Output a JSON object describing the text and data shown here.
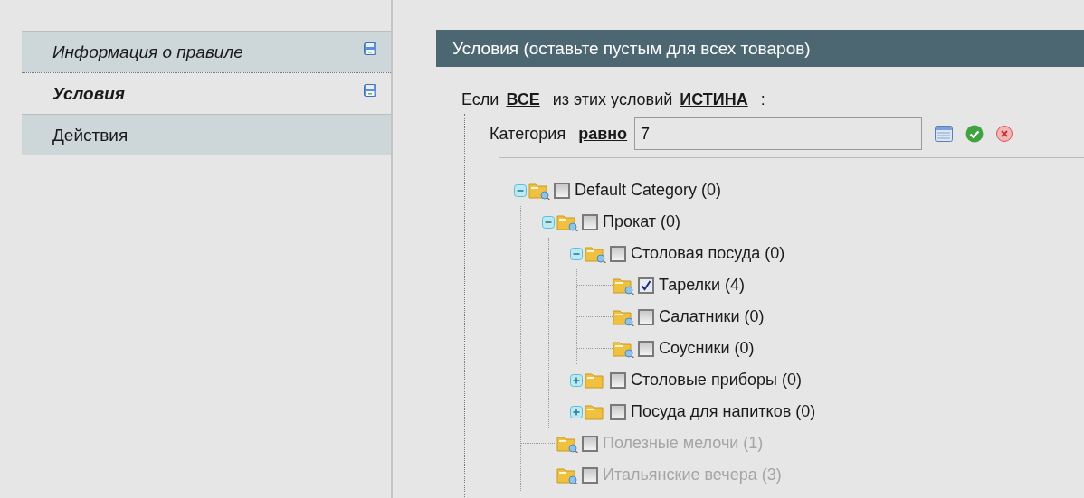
{
  "sidebar": {
    "items": [
      {
        "label": "Информация о правиле",
        "selected": false,
        "changed": true
      },
      {
        "label": "Условия",
        "selected": true,
        "changed": true
      },
      {
        "label": "Действия",
        "selected": false,
        "changed": false
      }
    ]
  },
  "section": {
    "title": "Условия (оставьте пустым для всех товаров)",
    "condition": {
      "prefix": "Если",
      "aggregator": "ВСЕ",
      "middle": "из этих условий",
      "value": "ИСТИНА",
      "suffix": ":"
    },
    "rule": {
      "attribute": "Категория",
      "operator": "равно",
      "value": "7"
    },
    "tree": [
      {
        "label": "Default Category (0)",
        "checked": false,
        "disabled": false,
        "expanded": true,
        "children": [
          {
            "label": "Прокат (0)",
            "checked": false,
            "disabled": false,
            "expanded": true,
            "children": [
              {
                "label": "Столовая посуда (0)",
                "checked": false,
                "disabled": false,
                "expanded": true,
                "children": [
                  {
                    "label": "Тарелки (4)",
                    "checked": true,
                    "disabled": false
                  },
                  {
                    "label": "Салатники (0)",
                    "checked": false,
                    "disabled": false
                  },
                  {
                    "label": "Соусники (0)",
                    "checked": false,
                    "disabled": false
                  }
                ]
              },
              {
                "label": "Столовые приборы (0)",
                "checked": false,
                "disabled": false,
                "expanded": false
              },
              {
                "label": "Посуда для напитков (0)",
                "checked": false,
                "disabled": false,
                "expanded": false
              }
            ]
          },
          {
            "label": "Полезные мелочи (1)",
            "checked": false,
            "disabled": true
          },
          {
            "label": "Итальянские вечера (3)",
            "checked": false,
            "disabled": true
          }
        ]
      }
    ]
  }
}
